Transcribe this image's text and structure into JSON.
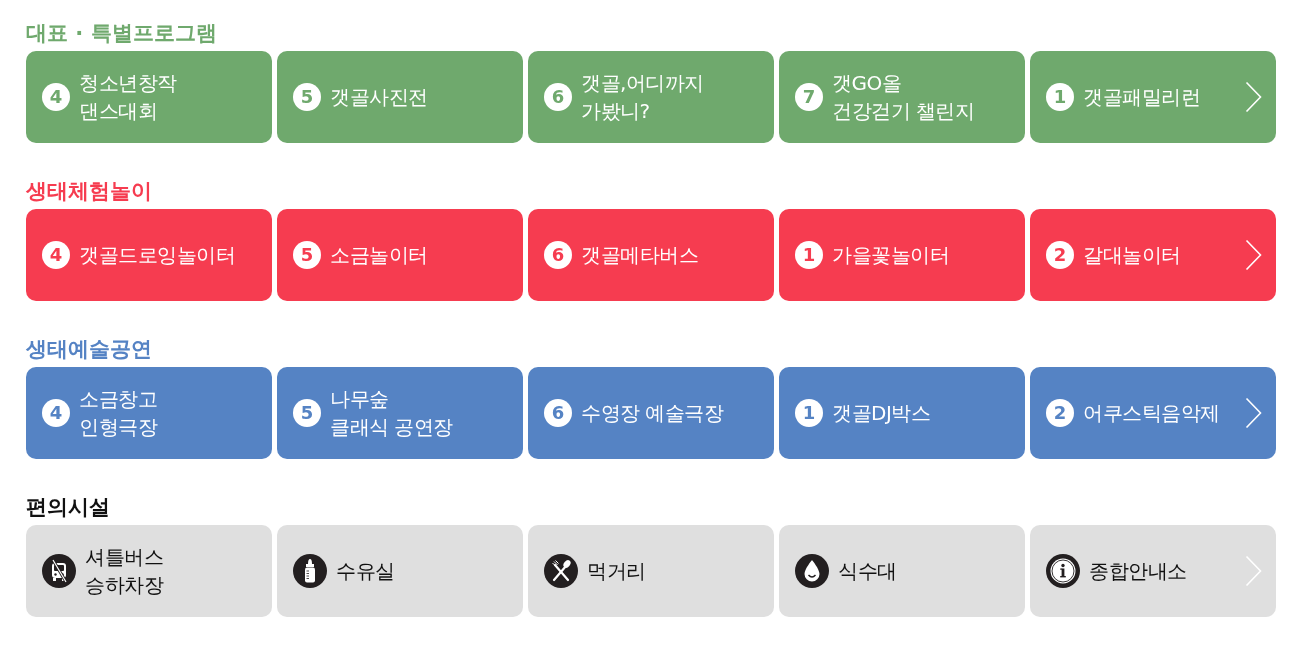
{
  "sections": [
    {
      "title": "대표 · 특별프로그램",
      "kind": "numbered",
      "color": "#6fa96d",
      "items": [
        {
          "number": "4",
          "label": "청소년창작\n댄스대회",
          "arrow": false
        },
        {
          "number": "5",
          "label": "갯골사진전",
          "arrow": false
        },
        {
          "number": "6",
          "label": "갯골,어디까지\n가봤니?",
          "arrow": false
        },
        {
          "number": "7",
          "label": "갯GO올\n건강걷기 챌린지",
          "arrow": false
        },
        {
          "number": "1",
          "label": "갯골패밀리런",
          "arrow": true
        }
      ]
    },
    {
      "title": "생태체험놀이",
      "kind": "numbered",
      "color": "#f63c50",
      "items": [
        {
          "number": "4",
          "label": "갯골드로잉놀이터",
          "arrow": false
        },
        {
          "number": "5",
          "label": "소금놀이터",
          "arrow": false
        },
        {
          "number": "6",
          "label": "갯골메타버스",
          "arrow": false
        },
        {
          "number": "1",
          "label": "가을꽃놀이터",
          "arrow": false
        },
        {
          "number": "2",
          "label": "갈대놀이터",
          "arrow": true
        }
      ]
    },
    {
      "title": "생태예술공연",
      "kind": "numbered",
      "color": "#5583c4",
      "items": [
        {
          "number": "4",
          "label": "소금창고\n인형극장",
          "arrow": false
        },
        {
          "number": "5",
          "label": "나무숲\n클래식 공연장",
          "arrow": false
        },
        {
          "number": "6",
          "label": "수영장 예술극장",
          "arrow": false
        },
        {
          "number": "1",
          "label": "갯골DJ박스",
          "arrow": false
        },
        {
          "number": "2",
          "label": "어쿠스틱음악제",
          "arrow": true
        }
      ]
    },
    {
      "title": "편의시설",
      "kind": "facility",
      "color": "#dfdfdf",
      "items": [
        {
          "kind": "shuttle",
          "label": "셔틀버스\n승하차장",
          "arrow": false
        },
        {
          "kind": "nursing",
          "label": "수유실",
          "arrow": false
        },
        {
          "kind": "food",
          "label": "먹거리",
          "arrow": false
        },
        {
          "kind": "water",
          "label": "식수대",
          "arrow": false
        },
        {
          "kind": "info",
          "label": "종합안내소",
          "arrow": true
        }
      ]
    }
  ]
}
